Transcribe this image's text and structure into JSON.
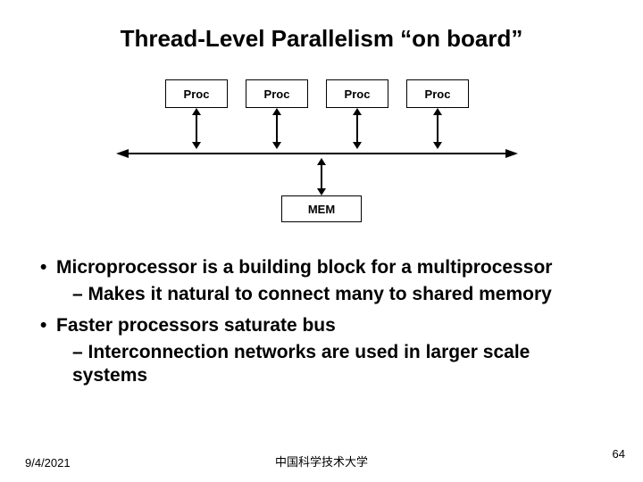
{
  "title": "Thread-Level Parallelism “on board”",
  "proc_label": "Proc",
  "mem_label": "MEM",
  "bullets": {
    "b1": "Microprocessor is a building block for a multiprocessor",
    "b1_sub": "– Makes it natural to connect many to shared memory",
    "b2": "Faster processors saturate bus",
    "b2_sub": "– Interconnection networks are used in larger scale systems"
  },
  "footer": {
    "date": "9/4/2021",
    "center": "中国科学技术大学",
    "page": "64"
  }
}
